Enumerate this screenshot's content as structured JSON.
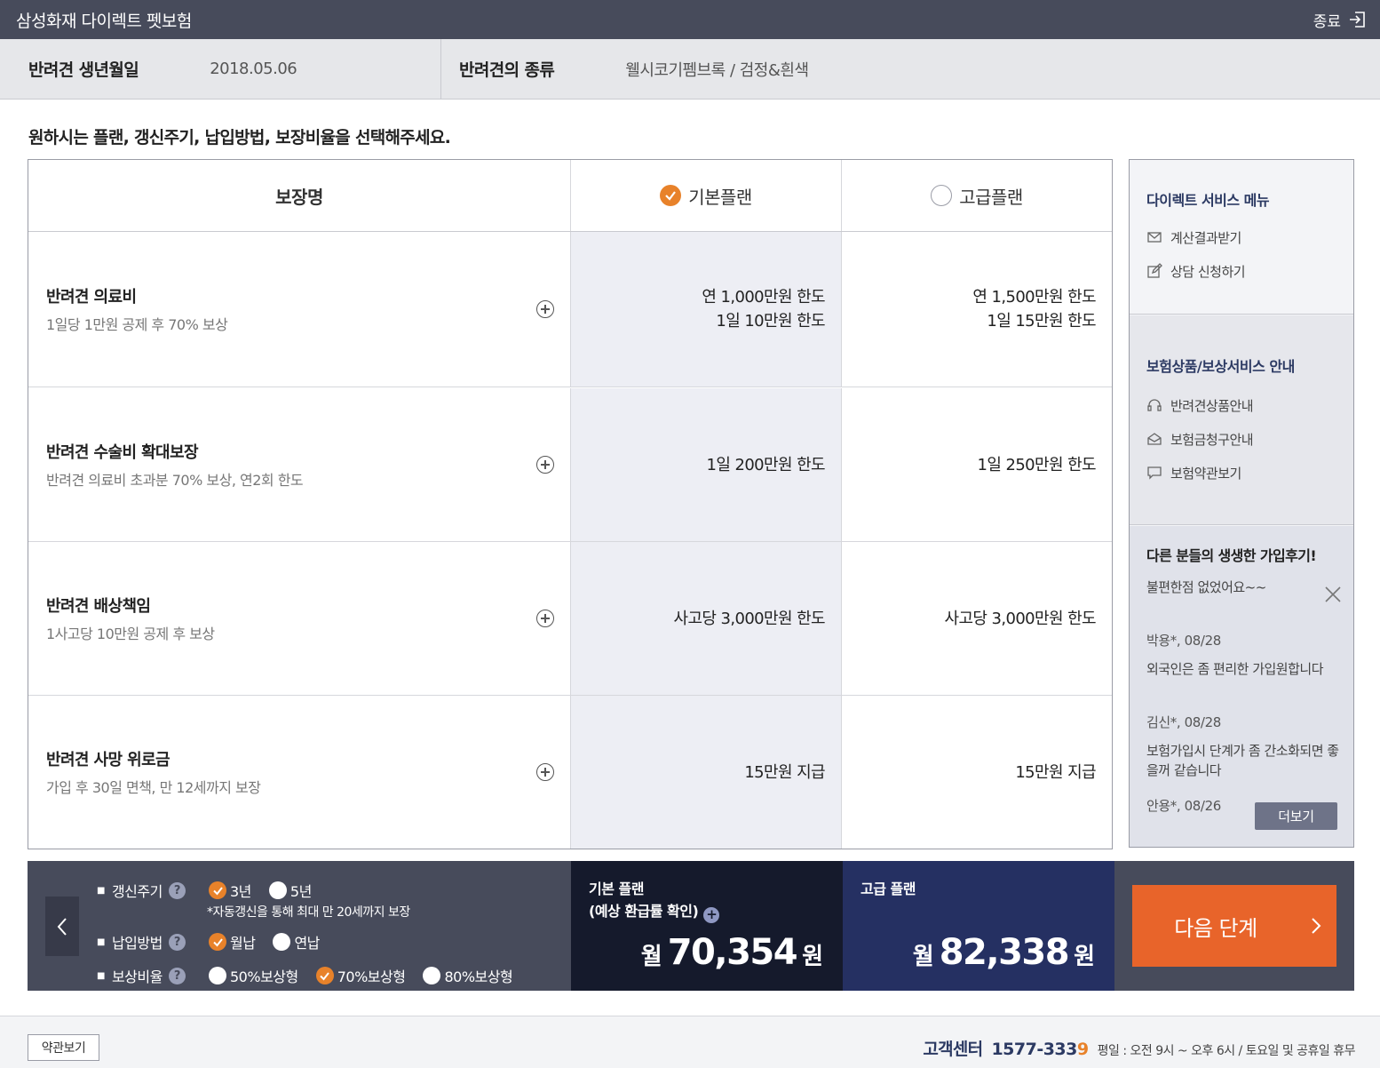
{
  "topbar": {
    "title": "삼성화재 다이렉트 펫보험",
    "exit_label": "종료"
  },
  "info": {
    "birth_label": "반려견 생년월일",
    "birth_value": "2018.05.06",
    "breed_label": "반려견의 종류",
    "breed_value": "웰시코기펨브록 / 검정&흰색"
  },
  "instruction": "원하시는 플랜, 갱신주기, 납입방법, 보장비율을 선택해주세요.",
  "table": {
    "header": {
      "name": "보장명",
      "basic": "기본플랜",
      "premium": "고급플랜"
    },
    "selected_plan": "basic",
    "rows": [
      {
        "title": "반려견 의료비",
        "desc": "1일당 1만원 공제 후 70% 보상",
        "basic": [
          "연 1,000만원 한도",
          "1일 10만원 한도"
        ],
        "premium": [
          "연 1,500만원 한도",
          "1일 15만원 한도"
        ]
      },
      {
        "title": "반려견 수술비 확대보장",
        "desc": "반려견 의료비 초과분 70% 보상, 연2회 한도",
        "basic": [
          "1일 200만원 한도"
        ],
        "premium": [
          "1일 250만원 한도"
        ]
      },
      {
        "title": "반려견 배상책임",
        "desc": "1사고당 10만원 공제 후 보상",
        "basic": [
          "사고당 3,000만원 한도"
        ],
        "premium": [
          "사고당 3,000만원 한도"
        ]
      },
      {
        "title": "반려견 사망 위로금",
        "desc": "가입 후 30일 면책, 만 12세까지 보장",
        "basic": [
          "15만원 지급"
        ],
        "premium": [
          "15만원 지급"
        ]
      }
    ]
  },
  "side": {
    "direct_title": "다이렉트 서비스 메뉴",
    "direct_items": [
      {
        "label": "계산결과받기",
        "icon": "mail-icon"
      },
      {
        "label": "상담 신청하기",
        "icon": "edit-icon"
      }
    ],
    "guide_title": "보험상품/보상서비스 안내",
    "guide_items": [
      {
        "label": "반려견상품안내",
        "icon": "headset-icon"
      },
      {
        "label": "보험금청구안내",
        "icon": "envelope-open-icon"
      },
      {
        "label": "보험약관보기",
        "icon": "chat-icon"
      }
    ],
    "reviews_title": "다른 분들의 생생한 가입후기!",
    "reviews": [
      {
        "text": "불편한점 없었어요~~",
        "author": "박용*, 08/28"
      },
      {
        "text": "외국인은 좀 편리한 가입원합니다",
        "author": "김신*, 08/28"
      },
      {
        "text": "보험가입시 단계가 좀 간소화되면 좋을꺼 같습니다",
        "author": "안용*, 08/26"
      }
    ],
    "more_label": "더보기"
  },
  "options": {
    "renewal": {
      "label": "갱신주기",
      "choices": [
        "3년",
        "5년"
      ],
      "selected": "3년",
      "note": "*자동갱신을 통해 최대 만 20세까지 보장"
    },
    "payment": {
      "label": "납입방법",
      "choices": [
        "월납",
        "연납"
      ],
      "selected": "월납"
    },
    "ratio": {
      "label": "보상비율",
      "choices": [
        "50%보상형",
        "70%보상형",
        "80%보상형"
      ],
      "selected": "70%보상형"
    },
    "help_symbol": "?"
  },
  "prices": {
    "basic": {
      "label1": "기본 플랜",
      "label2": "(예상 환급률 확인)",
      "prefix": "월",
      "amount": "70,354",
      "unit": "원"
    },
    "premium": {
      "label1": "고급 플랜",
      "prefix": "월",
      "amount": "82,338",
      "unit": "원"
    }
  },
  "next_label": "다음 단계",
  "footer": {
    "terms_label": "약관보기",
    "cs_label": "고객센터",
    "cs_number_main": "1577-333",
    "cs_number_last": "9",
    "hours": "평일 : 오전 9시 ~ 오후 6시 / 토요일 및 공휴일 휴무"
  },
  "colors": {
    "accent": "#e8822a",
    "next": "#e8642a",
    "dark": "#474b5b",
    "navy": "#253062"
  }
}
